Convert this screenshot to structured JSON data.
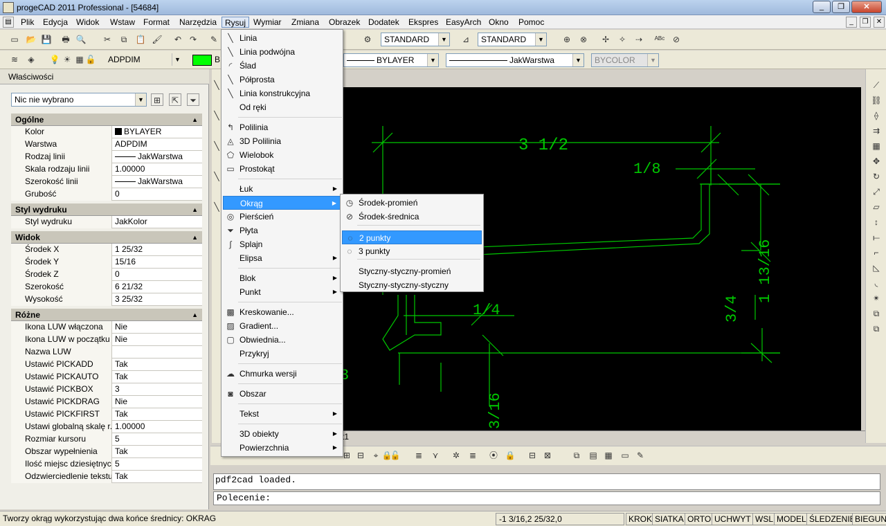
{
  "window": {
    "title": "progeCAD 2011 Professional - [54684]",
    "minimize_icon": "minimize-icon",
    "restore_icon": "restore-icon",
    "close_icon": "close-icon"
  },
  "menubar": {
    "items": [
      "Plik",
      "Edycja",
      "Widok",
      "Wstaw",
      "Format",
      "Narzędzia",
      "Rysuj",
      "Wymiar",
      "Zmiana",
      "Obrazek",
      "Dodatek",
      "Ekspres",
      "EasyArch",
      "Okno",
      "Pomoc"
    ],
    "active": "Rysuj"
  },
  "toolbar": {
    "textstyle": "STANDARD",
    "dimstyle": "STANDARD",
    "layer": "ADPDIM",
    "linetype_color": "BYLAYER",
    "lineweight": "JakWarstwa",
    "plotstyle": "BYCOLOR",
    "color_swatch_label": "B"
  },
  "properties": {
    "title": "Właściwości",
    "selection": "Nic nie wybrano",
    "sections": [
      {
        "title": "Ogólne",
        "rows": [
          {
            "k": "Kolor",
            "v": "BYLAYER"
          },
          {
            "k": "Warstwa",
            "v": "ADPDIM"
          },
          {
            "k": "Rodzaj linii",
            "v": "JakWarstwa"
          },
          {
            "k": "Skala rodzaju linii",
            "v": "1.00000"
          },
          {
            "k": "Szerokość linii",
            "v": "JakWarstwa"
          },
          {
            "k": "Grubość",
            "v": "0"
          }
        ]
      },
      {
        "title": "Styl wydruku",
        "rows": [
          {
            "k": "Styl wydruku",
            "v": "JakKolor"
          }
        ]
      },
      {
        "title": "Widok",
        "rows": [
          {
            "k": "Środek X",
            "v": "1 25/32"
          },
          {
            "k": "Środek Y",
            "v": "15/16"
          },
          {
            "k": "Środek Z",
            "v": "0"
          },
          {
            "k": "Szerokość",
            "v": "6 21/32"
          },
          {
            "k": "Wysokość",
            "v": "3 25/32"
          }
        ]
      },
      {
        "title": "Różne",
        "rows": [
          {
            "k": "Ikona LUW włączona",
            "v": "Nie"
          },
          {
            "k": "Ikona LUW w początku",
            "v": "Nie"
          },
          {
            "k": "Nazwa LUW",
            "v": ""
          },
          {
            "k": "Ustawić PICKADD",
            "v": "Tak"
          },
          {
            "k": "Ustawić PICKAUTO",
            "v": "Tak"
          },
          {
            "k": "Ustawić PICKBOX",
            "v": "3"
          },
          {
            "k": "Ustawić PICKDRAG",
            "v": "Nie"
          },
          {
            "k": "Ustawić PICKFIRST",
            "v": "Tak"
          },
          {
            "k": "Ustawi globalną skalę r...",
            "v": "1.00000"
          },
          {
            "k": "Rozmiar kursoru",
            "v": "5"
          },
          {
            "k": "Obszar wypełnienia",
            "v": "Tak"
          },
          {
            "k": "Ilość miejsc dziesiętnych",
            "v": "5"
          },
          {
            "k": "Odzwierciedlenie tekstu",
            "v": "Tak"
          }
        ]
      }
    ]
  },
  "rysuj_menu": {
    "items": [
      {
        "label": "Linia",
        "icon": "line-icon",
        "sub": false
      },
      {
        "label": "Linia podwójna",
        "icon": "double-line-icon",
        "sub": false
      },
      {
        "label": "Ślad",
        "icon": "trace-icon",
        "sub": false
      },
      {
        "label": "Półprosta",
        "icon": "ray-icon",
        "sub": false
      },
      {
        "label": "Linia konstrukcyjna",
        "icon": "xline-icon",
        "sub": false
      },
      {
        "label": "Od ręki",
        "icon": "",
        "sub": false
      },
      {
        "label": "Polilinia",
        "icon": "polyline-icon",
        "sub": false
      },
      {
        "label": "3D Polilinia",
        "icon": "3d-polyline-icon",
        "sub": false
      },
      {
        "label": "Wielobok",
        "icon": "polygon-icon",
        "sub": false
      },
      {
        "label": "Prostokąt",
        "icon": "rectangle-icon",
        "sub": false
      },
      {
        "label": "Łuk",
        "icon": "",
        "sub": true
      },
      {
        "label": "Okrąg",
        "icon": "",
        "sub": true
      },
      {
        "label": "Pierścień",
        "icon": "donut-icon",
        "sub": false
      },
      {
        "label": "Płyta",
        "icon": "plane-icon",
        "sub": false
      },
      {
        "label": "Splajn",
        "icon": "spline-icon",
        "sub": false
      },
      {
        "label": "Elipsa",
        "icon": "",
        "sub": true
      },
      {
        "label": "Blok",
        "icon": "",
        "sub": true
      },
      {
        "label": "Punkt",
        "icon": "",
        "sub": true
      },
      {
        "label": "Kreskowanie...",
        "icon": "hatch-icon",
        "sub": false
      },
      {
        "label": "Gradient...",
        "icon": "gradient-icon",
        "sub": false
      },
      {
        "label": "Obwiednia...",
        "icon": "boundary-icon",
        "sub": false
      },
      {
        "label": "Przykryj",
        "icon": "",
        "sub": false
      },
      {
        "label": "Chmurka wersji",
        "icon": "revcloud-icon",
        "sub": false
      },
      {
        "label": "Obszar",
        "icon": "region-icon",
        "sub": false
      },
      {
        "label": "Tekst",
        "icon": "",
        "sub": true
      },
      {
        "label": "3D obiekty",
        "icon": "",
        "sub": true
      },
      {
        "label": "Powierzchnia",
        "icon": "",
        "sub": true
      }
    ],
    "highlighted": "Okrąg"
  },
  "okrag_menu": {
    "items": [
      {
        "label": "Środek-promień",
        "icon": "circle-center-radius-icon"
      },
      {
        "label": "Środek-średnica",
        "icon": "circle-center-diameter-icon"
      },
      {
        "label": "2 punkty",
        "icon": "circle-2-point-icon"
      },
      {
        "label": "3 punkty",
        "icon": "circle-3-point-icon"
      },
      {
        "label": "Styczny-styczny-promień",
        "icon": ""
      },
      {
        "label": "Styczny-styczny-styczny",
        "icon": ""
      }
    ],
    "selected": "2 punkty"
  },
  "drawing": {
    "dims": [
      "3 1/2",
      "1/8",
      "1 13/16",
      "3/4",
      "1/4",
      "3/16",
      "3"
    ],
    "layout_tab": "t1",
    "line_color": "#00c800",
    "background": "#000000"
  },
  "command": {
    "history": "pdf2cad loaded.",
    "prompt": "Polecenie:"
  },
  "status": {
    "message": "Tworzy okrąg wykorzystując dwa końce średnicy: OKRAG",
    "coords": "-1 3/16,2 25/32,0",
    "buttons": [
      "KROK",
      "SIATKA",
      "ORTO",
      "UCHWYT",
      "WSL",
      "MODEL",
      "ŚLEDZENIE",
      "BIEGUN"
    ]
  }
}
